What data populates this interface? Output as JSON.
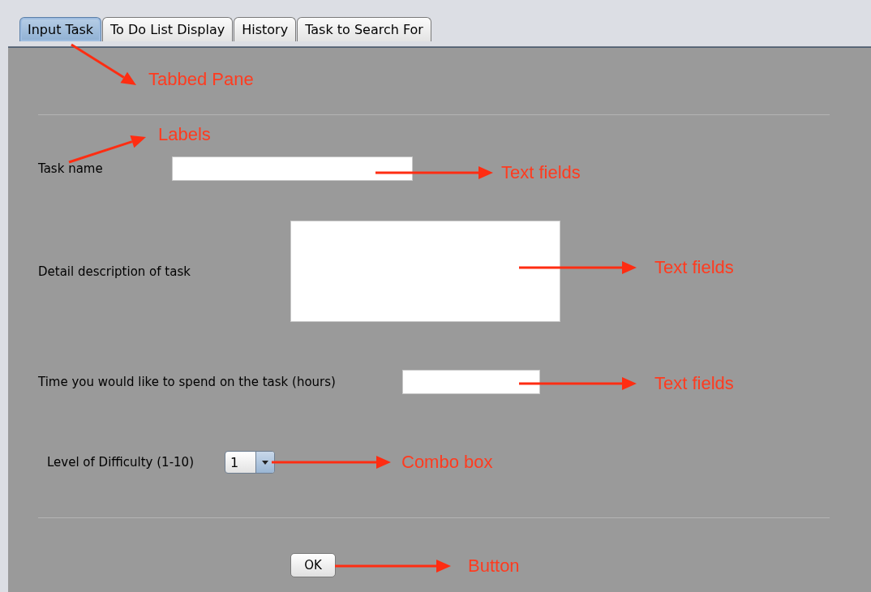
{
  "tabs": [
    {
      "label": "Input Task",
      "selected": true
    },
    {
      "label": "To Do List Display",
      "selected": false
    },
    {
      "label": "History",
      "selected": false
    },
    {
      "label": "Task to Search For",
      "selected": false
    }
  ],
  "form": {
    "rows": [
      {
        "kind": "text",
        "label": "Task name"
      },
      {
        "kind": "textarea",
        "label": "Detail description of task"
      },
      {
        "kind": "text",
        "label": "Time you would like to spend on the task (hours)"
      },
      {
        "kind": "combo",
        "label": "Level of Difficulty (1-10)",
        "value": "1"
      }
    ],
    "button": "OK"
  },
  "annotations": [
    {
      "label": "Tabbed Pane"
    },
    {
      "label": "Labels"
    },
    {
      "label": "Text fields"
    },
    {
      "label": "Text fields"
    },
    {
      "label": "Text fields"
    },
    {
      "label": "Combo box"
    },
    {
      "label": "Button"
    }
  ]
}
